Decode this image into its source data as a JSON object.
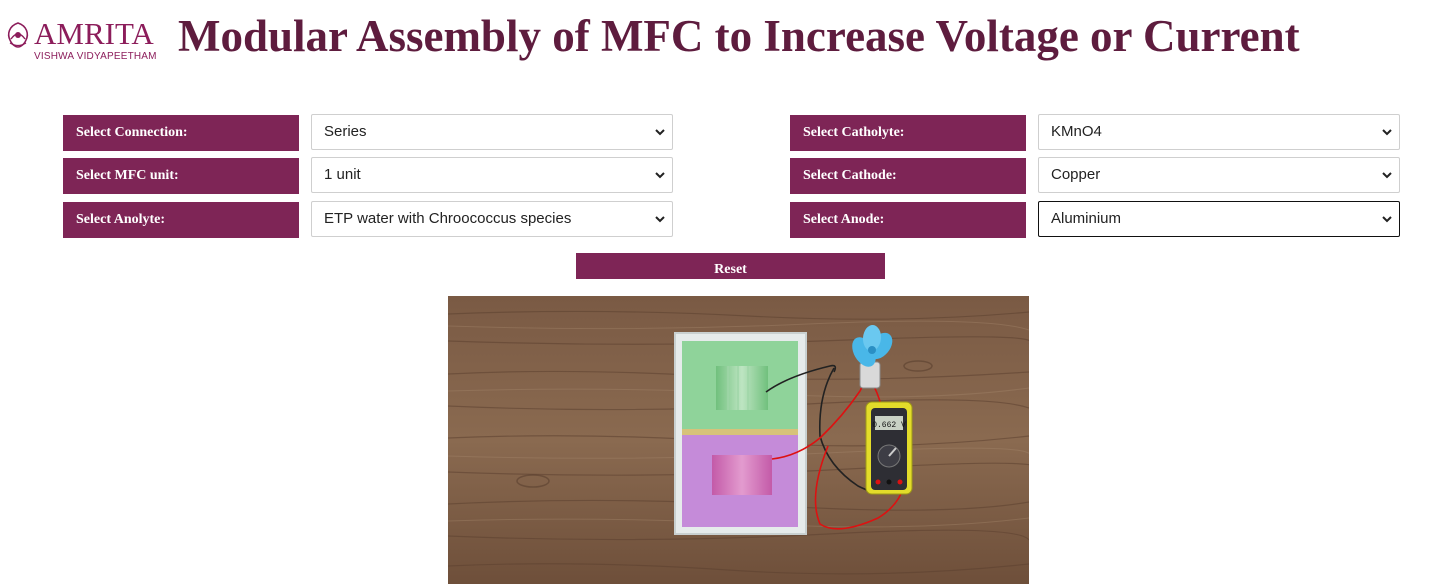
{
  "header": {
    "logo_text": "AMRITA",
    "logo_subtext": "VISHWA VIDYAPEETHAM",
    "title": "Modular Assembly of MFC to Increase Voltage or Current"
  },
  "controls": {
    "connection": {
      "label": "Select Connection:",
      "value": "Series"
    },
    "mfc_unit": {
      "label": "Select MFC unit:",
      "value": "1 unit"
    },
    "anolyte": {
      "label": "Select Anolyte:",
      "value": "ETP water with Chroococcus species"
    },
    "catholyte": {
      "label": "Select Catholyte:",
      "value": "KMnO4"
    },
    "cathode": {
      "label": "Select Cathode:",
      "value": "Copper"
    },
    "anode": {
      "label": "Select Anode:",
      "value": "Aluminium"
    },
    "reset_label": "Reset"
  },
  "simulation": {
    "multimeter_reading": "0.662 V",
    "colors": {
      "brand": "#7e2556",
      "title": "#5e1c3e",
      "cathode_chamber": "#8fd39a",
      "anode_chamber": "#c58bd9",
      "fan": "#49b7e8",
      "multimeter": "#e3dc2a"
    }
  }
}
